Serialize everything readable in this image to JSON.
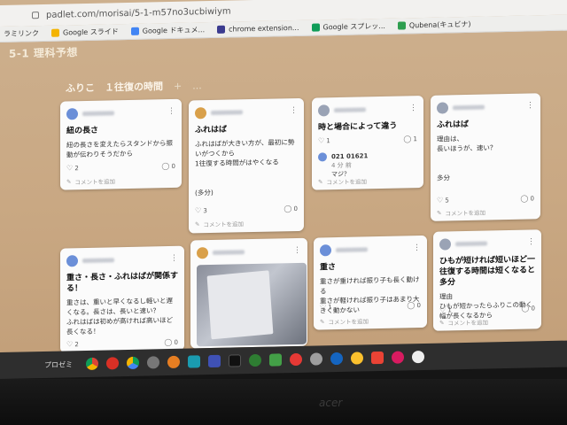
{
  "browser": {
    "url": "padlet.com/morisai/5-1-m57no3ucbiwiym",
    "bookmarks": [
      {
        "label": "ラミリンク"
      },
      {
        "label": "Google スライド"
      },
      {
        "label": "Google ドキュメ..."
      },
      {
        "label": "chrome extension..."
      },
      {
        "label": "Google スプレッ..."
      },
      {
        "label": "Qubena(キュビナ)"
      }
    ]
  },
  "board": {
    "title": "5-1 理科予想",
    "column_title": "ふりこ　１往復の時間",
    "column_add": "+",
    "column_more": "..."
  },
  "cards": [
    {
      "title": "紐の長さ",
      "body": "紐の長さを変えたらスタンドから振動が伝わりそうだから",
      "likes": "2",
      "comments": "0",
      "add_comment": "コメントを追加"
    },
    {
      "title": "ふれはば",
      "body": "ふれはばが大きい方が、最初に勢いがつくから\n1往復する時間がはやくなる\n\n\n(多分)",
      "likes": "3",
      "comments": "0",
      "add_comment": "コメントを追加"
    },
    {
      "title": "時と場合によって違う",
      "likes": "1",
      "comments": "1",
      "reply_name": "021 01621",
      "reply_time": "4 分 前",
      "reply_text": "マジ？",
      "add_comment": "コメントを追加"
    },
    {
      "title": "ふれはば",
      "body": "理由は、\n長いほうが、速い？\n\n\n多分",
      "likes": "5",
      "comments": "0",
      "add_comment": "コメントを追加"
    },
    {
      "title": "重さ・長さ・ふれはばが関係する！",
      "body": "重さは、重いと早くなるし軽いと遅くなる。長さは、長いと速い？\nふれはばは初めが高ければ高いほど長くなる！",
      "likes": "2",
      "comments": "0"
    },
    {
      "likes": "",
      "comments": ""
    },
    {
      "title": "重さ",
      "body": "重さが重ければ振り子も長く動ける\n重さが軽ければ振り子はあまり大きく動かない",
      "likes": "1",
      "comments": "0",
      "add_comment": "コメントを追加"
    },
    {
      "title": "ひもが短ければ短いほど一往復する時間は短くなると多分",
      "body": "理由\nひもが短かったらふりこの動く幅が長くなるから",
      "likes": "1",
      "comments": "0",
      "add_comment": "コメントを追加"
    }
  ],
  "taskbar": {
    "label": "プロゼミ",
    "icons": [
      "chrome-icon",
      "app-red-icon",
      "drive-icon",
      "dots-icon",
      "app-orange-icon",
      "app-teal-icon",
      "app-blue-icon",
      "app-black-icon",
      "app-green-icon",
      "app-green2-icon",
      "app-red2-icon",
      "app-gray-icon",
      "app-darkblue-icon",
      "app-yellow-icon",
      "gmail-icon",
      "app-pink-icon",
      "app-white-icon"
    ]
  },
  "colors": {
    "background": "#c9a883",
    "card": "#fbfbfb",
    "taskbar": "#2e2e2e"
  }
}
